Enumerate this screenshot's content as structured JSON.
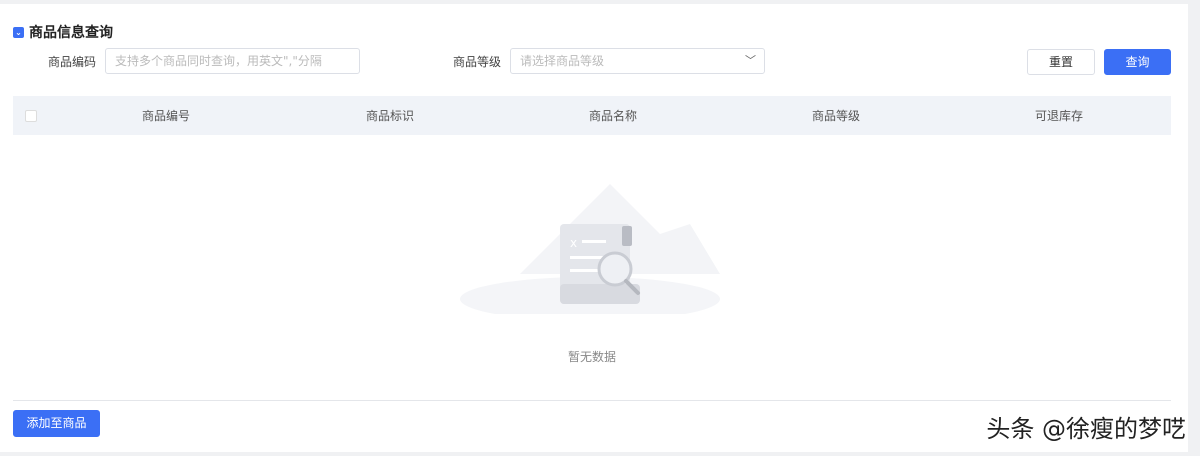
{
  "section_title": "商品信息查询",
  "filters": {
    "code_label": "商品编码",
    "code_placeholder": "支持多个商品同时查询，用英文\",\"分隔",
    "level_label": "商品等级",
    "level_placeholder": "请选择商品等级"
  },
  "buttons": {
    "reset": "重置",
    "query": "查询",
    "add": "添加至商品"
  },
  "table": {
    "columns": [
      "商品编号",
      "商品标识",
      "商品名称",
      "商品等级",
      "可退库存"
    ],
    "empty_text": "暂无数据"
  },
  "watermark": "头条 @徐瘦的梦呓",
  "colors": {
    "primary": "#3b6ff5"
  }
}
